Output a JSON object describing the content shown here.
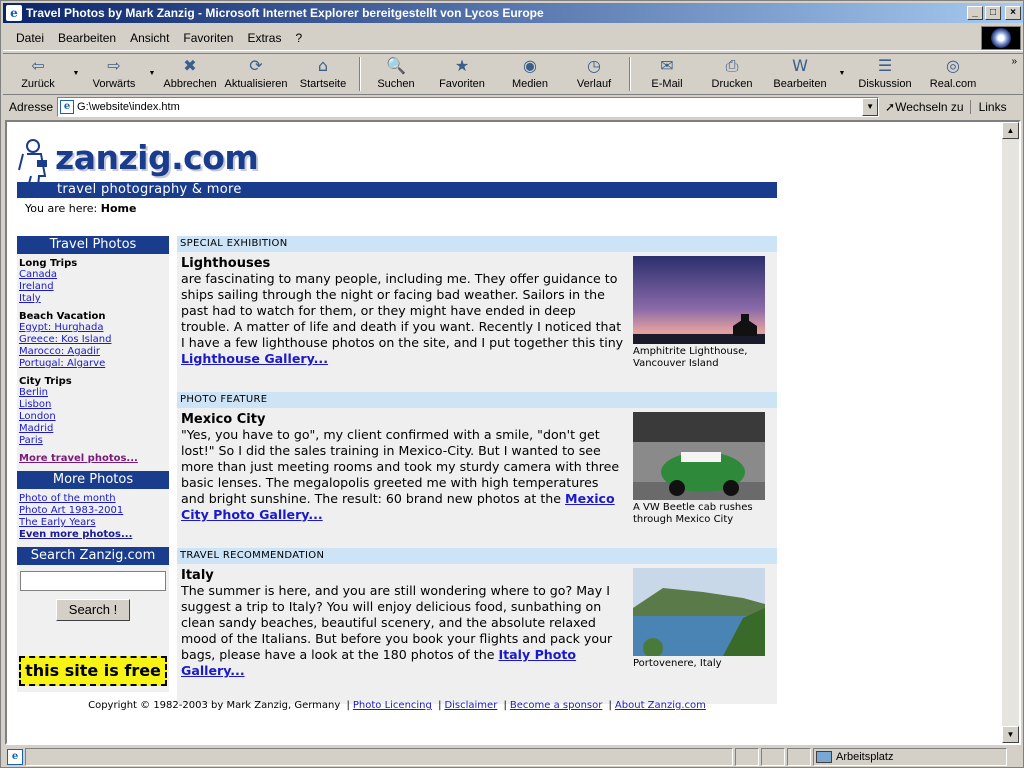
{
  "window": {
    "title": "Travel Photos by Mark Zanzig - Microsoft Internet Explorer bereitgestellt von Lycos Europe",
    "minimize": "_",
    "maximize": "□",
    "close": "×"
  },
  "menu": [
    {
      "label": "Datei"
    },
    {
      "label": "Bearbeiten"
    },
    {
      "label": "Ansicht"
    },
    {
      "label": "Favoriten"
    },
    {
      "label": "Extras"
    },
    {
      "label": "?"
    }
  ],
  "toolbar": [
    {
      "label": "Zurück",
      "icon": "back-arrow-icon",
      "glyph": "⇦"
    },
    {
      "label": "Vorwärts",
      "icon": "forward-arrow-icon",
      "glyph": "⇨"
    },
    {
      "label": "Abbrechen",
      "icon": "stop-icon",
      "glyph": "✖"
    },
    {
      "label": "Aktualisieren",
      "icon": "refresh-icon",
      "glyph": "⟳"
    },
    {
      "label": "Startseite",
      "icon": "home-icon",
      "glyph": "⌂"
    },
    {
      "label": "Suchen",
      "icon": "search-icon",
      "glyph": "🔍"
    },
    {
      "label": "Favoriten",
      "icon": "favorites-icon",
      "glyph": "★"
    },
    {
      "label": "Medien",
      "icon": "media-icon",
      "glyph": "◉"
    },
    {
      "label": "Verlauf",
      "icon": "history-icon",
      "glyph": "◷"
    },
    {
      "label": "E-Mail",
      "icon": "mail-icon",
      "glyph": "✉"
    },
    {
      "label": "Drucken",
      "icon": "print-icon",
      "glyph": "⎙"
    },
    {
      "label": "Bearbeiten",
      "icon": "edit-word-icon",
      "glyph": "W"
    },
    {
      "label": "Diskussion",
      "icon": "discussion-icon",
      "glyph": "☰"
    },
    {
      "label": "Real.com",
      "icon": "realcom-icon",
      "glyph": "◎"
    }
  ],
  "address": {
    "label": "Adresse",
    "value": "G:\\website\\index.htm",
    "go": "Wechseln zu",
    "links": "Links"
  },
  "site": {
    "logo": "zanzig.com",
    "tagline": "travel photography & more",
    "breadcrumb_prefix": "You are here:",
    "breadcrumb_current": "Home"
  },
  "nav": {
    "travel_head": "Travel Photos",
    "groups": [
      {
        "title": "Long Trips",
        "links": [
          "Canada",
          "Ireland",
          "Italy"
        ]
      },
      {
        "title": "Beach Vacation",
        "links": [
          "Egypt: Hurghada",
          "Greece: Kos Island",
          "Marocco: Agadir",
          "Portugal: Algarve"
        ]
      },
      {
        "title": "City Trips",
        "links": [
          "Berlin",
          "Lisbon",
          "London",
          "Madrid",
          "Paris"
        ]
      }
    ],
    "more_travel": "More travel photos...",
    "more_head": "More Photos",
    "more_links": [
      "Photo of the month",
      "Photo Art 1983-2001",
      "The Early Years"
    ],
    "even_more": "Even more photos...",
    "search_head": "Search Zanzig.com",
    "search_placeholder": "",
    "search_button": "Search !",
    "free_badge": "this site is free"
  },
  "sections": [
    {
      "head": "SPECIAL EXHIBITION",
      "title": "Lighthouses",
      "text": "are fascinating to many people, including me. They offer guidance to ships sailing through the night or facing bad weather. Sailors in the past had to watch for them, or they might have ended in deep trouble. A matter of life and death if you want. Recently I noticed that I have a few lighthouse photos on the site, and I put together this tiny ",
      "link": "Lighthouse Gallery...",
      "caption": "Amphitrite Lighthouse, Vancouver Island"
    },
    {
      "head": "PHOTO FEATURE",
      "title": "Mexico City",
      "text": "\"Yes, you have to go\", my client confirmed with a smile, \"don't get lost!\" So I did the sales training in Mexico-City. But I wanted to see more than just meeting rooms and took my sturdy camera with three basic lenses. The megalopolis greeted me with high temperatures and bright sunshine. The result: 60 brand new photos at the ",
      "link": "Mexico City Photo Gallery...",
      "caption": "A VW Beetle cab rushes through Mexico City"
    },
    {
      "head": "TRAVEL RECOMMENDATION",
      "title": "Italy",
      "text": "The summer is here, and you are still wondering where to go? May I suggest a trip to Italy? You will enjoy delicious food, sunbathing on clean sandy beaches, beautiful scenery, and the absolute relaxed mood of the Italians. But before you book your flights and pack your bags, please have a look at the 180 photos of the ",
      "link": "Italy Photo Gallery...",
      "caption": "Portovenere, Italy"
    }
  ],
  "footer": {
    "copyright": "Copyright © 1982-2003 by Mark Zanzig, Germany",
    "links": [
      "Photo Licencing",
      "Disclaimer",
      "Become a sponsor",
      "About Zanzig.com"
    ]
  },
  "status": {
    "zone": "Arbeitsplatz"
  },
  "colors": {
    "brand_blue": "#1a3c8c",
    "section_head": "#cde4f7",
    "link": "#1a1acc",
    "badge_yellow": "#f7f315"
  }
}
